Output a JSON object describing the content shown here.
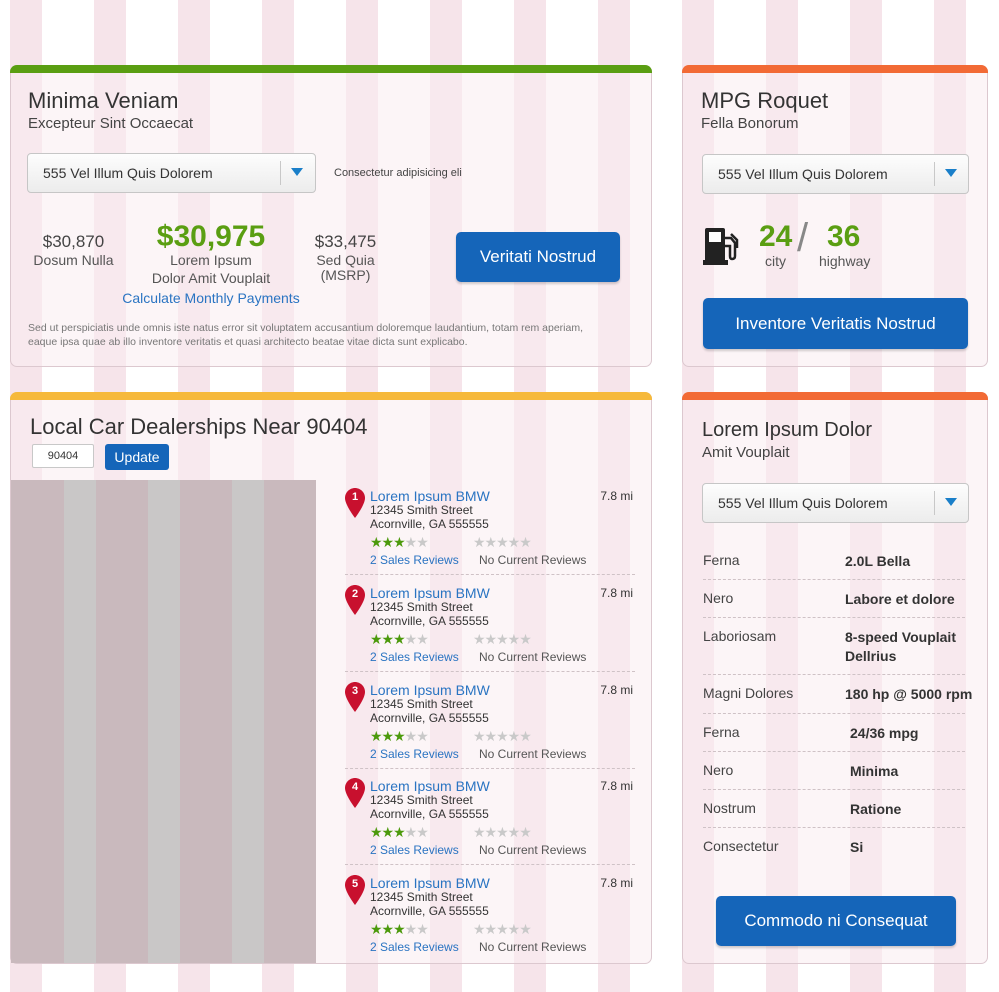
{
  "pricing_card": {
    "title": "Minima Veniam",
    "subtitle": "Excepteur Sint Occaecat",
    "select_value": "555 Vel Illum Quis Dolorem",
    "select_note": "Consectetur adipisicing eli",
    "price_left": "$30,870",
    "price_left_label": "Dosum Nulla",
    "price_main": "$30,975",
    "price_main_label1": "Lorem Ipsum",
    "price_main_label2": "Dolor Amit Vouplait",
    "calc_link": "Calculate Monthly Payments",
    "price_right": "$33,475",
    "price_right_label1": "Sed Quia",
    "price_right_label2": "(MSRP)",
    "button": "Veritati Nostrud",
    "disclaimer1": "Sed ut perspiciatis unde omnis iste natus error sit voluptatem accusantium doloremque laudantium, totam rem aperiam,",
    "disclaimer2": "eaque ipsa quae ab illo inventore veritatis et quasi architecto beatae vitae dicta sunt explicabo.",
    "accent_color": "#5a9e12",
    "price_color": "#5a9e12"
  },
  "mpg_card": {
    "title": "MPG Roquet",
    "subtitle": "Fella Bonorum",
    "select_value": "555 Vel Illum Quis Dolorem",
    "city": "24",
    "city_label": "city",
    "slash": "/",
    "highway": "36",
    "highway_label": "highway",
    "icon": "fuel-pump-icon",
    "button": "Inventore Veritatis Nostrud",
    "accent_color": "#f26a35"
  },
  "dealers_card": {
    "title": "Local Car Dealerships Near 90404",
    "zip_value": "90404",
    "update_button": "Update",
    "accent_color": "#f6b93b",
    "dealers": [
      {
        "num": "1",
        "name": "Lorem Ipsum BMW",
        "street": "12345 Smith Street",
        "city": "Acornville, GA 555555",
        "distance": "7.8 mi",
        "rating": 3,
        "sales_reviews": "2 Sales Reviews",
        "other_reviews": "No Current Reviews"
      },
      {
        "num": "2",
        "name": "Lorem Ipsum BMW",
        "street": "12345 Smith Street",
        "city": "Acornville, GA 555555",
        "distance": "7.8 mi",
        "rating": 3,
        "sales_reviews": "2 Sales Reviews",
        "other_reviews": "No Current Reviews"
      },
      {
        "num": "3",
        "name": "Lorem Ipsum BMW",
        "street": "12345 Smith Street",
        "city": "Acornville, GA 555555",
        "distance": "7.8 mi",
        "rating": 3,
        "sales_reviews": "2 Sales Reviews",
        "other_reviews": "No Current Reviews"
      },
      {
        "num": "4",
        "name": "Lorem Ipsum BMW",
        "street": "12345 Smith Street",
        "city": "Acornville, GA 555555",
        "distance": "7.8 mi",
        "rating": 3,
        "sales_reviews": "2 Sales Reviews",
        "other_reviews": "No Current Reviews"
      },
      {
        "num": "5",
        "name": "Lorem Ipsum BMW",
        "street": "12345 Smith Street",
        "city": "Acornville, GA 555555",
        "distance": "7.8 mi",
        "rating": 3,
        "sales_reviews": "2 Sales Reviews",
        "other_reviews": "No Current Reviews"
      }
    ]
  },
  "specs_card": {
    "title": "Lorem Ipsum Dolor",
    "subtitle": "Amit Vouplait",
    "select_value": "555 Vel Illum Quis Dolorem",
    "accent_color": "#f26a35",
    "specs": [
      {
        "key": "Ferna",
        "value": "2.0L Bella"
      },
      {
        "key": "Nero",
        "value": "Labore et dolore"
      },
      {
        "key": "Laboriosam",
        "value": "8-speed Vouplait Dellrius"
      },
      {
        "key": "Magni Dolores",
        "value": "180 hp @ 5000 rpm"
      },
      {
        "key": "Ferna",
        "value": "24/36 mpg"
      },
      {
        "key": "Nero",
        "value": "Minima"
      },
      {
        "key": "Nostrum",
        "value": "Ratione"
      },
      {
        "key": "Consectetur",
        "value": "Si"
      }
    ],
    "button": "Commodo ni Consequat"
  }
}
